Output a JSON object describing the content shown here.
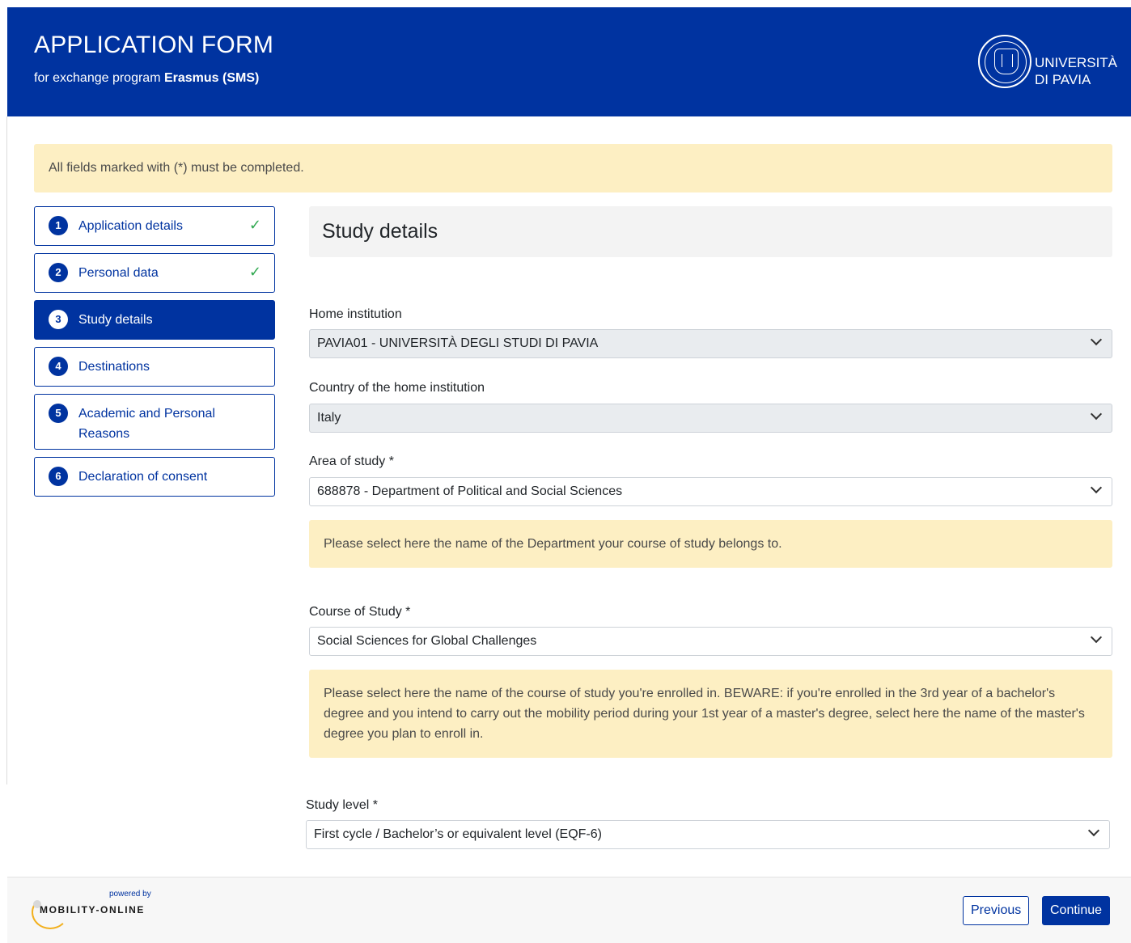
{
  "header": {
    "title": "APPLICATION FORM",
    "subtitle_prefix": "for exchange program ",
    "subtitle_program": "Erasmus (SMS)",
    "logo_line1": "UNIVERSITÀ",
    "logo_line2": "DI PAVIA"
  },
  "notice": "All fields marked with (*) must be completed.",
  "steps": [
    {
      "num": "1",
      "label": "Application details",
      "completed": true
    },
    {
      "num": "2",
      "label": "Personal data",
      "completed": true
    },
    {
      "num": "3",
      "label": "Study details",
      "active": true
    },
    {
      "num": "4",
      "label": "Destinations"
    },
    {
      "num": "5",
      "label": "Academic and Personal Reasons"
    },
    {
      "num": "6",
      "label": "Declaration of consent"
    }
  ],
  "check_glyph": "✓",
  "section_title": "Study details",
  "fields": {
    "home_institution": {
      "label": "Home institution",
      "value": "PAVIA01 - UNIVERSITÀ DEGLI STUDI DI PAVIA"
    },
    "country": {
      "label": "Country of the home institution",
      "value": "Italy"
    },
    "area": {
      "label": "Area of study *",
      "value": "688878 - Department of Political and Social Sciences",
      "hint": "Please select here the name of the Department your course of study belongs to."
    },
    "course": {
      "label": "Course of Study *",
      "value": "Social Sciences for Global Challenges",
      "hint": "Please select here the name of the course of study you're enrolled in. BEWARE: if you're enrolled in the 3rd year of a bachelor's degree and you intend to carry out the mobility period during your 1st year of a master's degree, select here the name of the master's degree you plan to enroll in."
    },
    "level": {
      "label": "Study level *",
      "value": "First cycle / Bachelor’s or equivalent level (EQF-6)"
    }
  },
  "footer": {
    "powered_by": "powered by",
    "brand": "MOBILITY-ONLINE",
    "previous": "Previous",
    "continue": "Continue"
  },
  "colors": {
    "brand_blue": "#0033a0",
    "notice_bg": "#fdefc3",
    "check_green": "#2fa84f"
  }
}
